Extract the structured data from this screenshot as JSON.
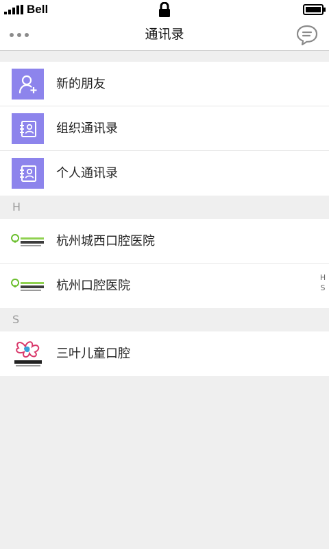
{
  "status_bar": {
    "carrier": "Bell"
  },
  "nav": {
    "title": "通讯录"
  },
  "menu_items": [
    {
      "label": "新的朋友",
      "icon": "add-user-icon"
    },
    {
      "label": "组织通讯录",
      "icon": "contact-book-icon"
    },
    {
      "label": "个人通讯录",
      "icon": "contact-book-icon"
    }
  ],
  "sections": [
    {
      "letter": "H",
      "contacts": [
        {
          "name": "杭州城西口腔医院",
          "logo": "hospital-logo"
        },
        {
          "name": "杭州口腔医院",
          "logo": "hospital-logo"
        }
      ]
    },
    {
      "letter": "S",
      "contacts": [
        {
          "name": "三叶儿童口腔",
          "logo": "sanye-logo"
        }
      ]
    }
  ],
  "index_bar": [
    "H",
    "S"
  ],
  "colors": {
    "accent_tile": "#8d84ec",
    "background": "#efefef"
  }
}
